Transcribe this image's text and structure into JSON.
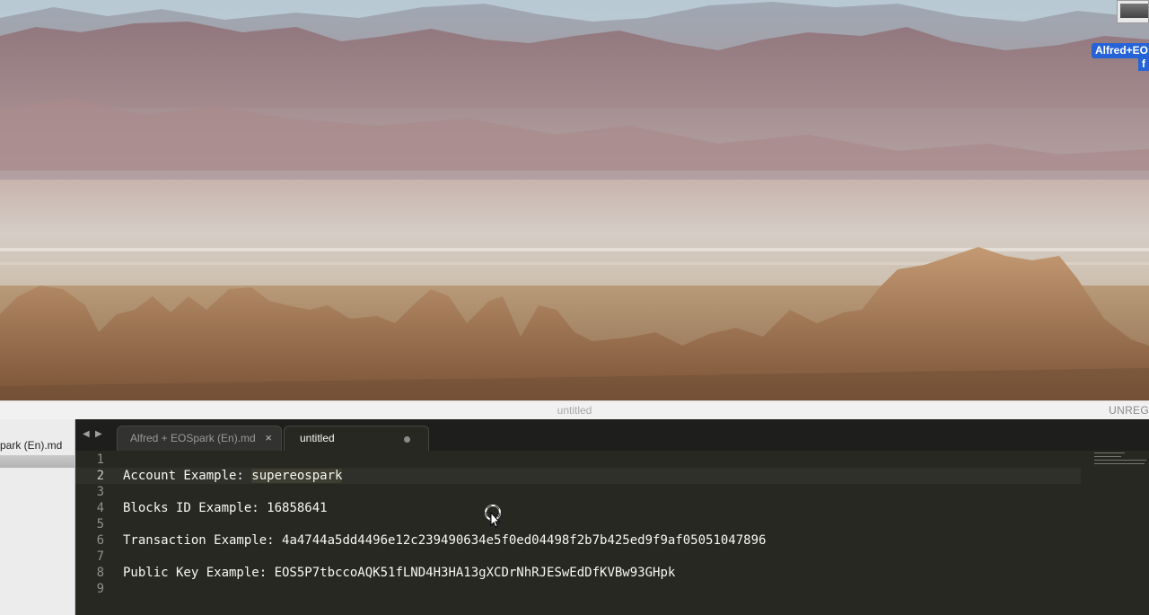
{
  "desktop": {
    "icon_label_line1": "Alfred+EO",
    "icon_label_line2": "f"
  },
  "window": {
    "title": "untitled",
    "unregistered_label": "UNREG"
  },
  "sidebar": {
    "open_file": "park (En).md"
  },
  "tabs": [
    {
      "label": "Alfred + EOSpark (En).md",
      "close_icon": "×"
    },
    {
      "label": "untitled",
      "modified_indicator": "dot"
    }
  ],
  "tab_nav": {
    "back": "◀",
    "forward": "▶"
  },
  "editor": {
    "line_numbers": [
      "1",
      "2",
      "3",
      "4",
      "5",
      "6",
      "7",
      "8",
      "9"
    ],
    "current_line": 2,
    "lines": [
      {
        "label": "",
        "value": ""
      },
      {
        "label": "Account Example: ",
        "value": "supereospark"
      },
      {
        "label": "",
        "value": ""
      },
      {
        "label": "Blocks ID Example: ",
        "value": "16858641"
      },
      {
        "label": "",
        "value": ""
      },
      {
        "label": "Transaction Example: ",
        "value": "4a4744a5dd4496e12c239490634e5f0ed04498f2b7b425ed9f9af05051047896"
      },
      {
        "label": "",
        "value": ""
      },
      {
        "label": "Public Key Example: ",
        "value": "EOS5P7tbccoAQK51fLND4H3HA13gXCDrNhRJESwEdDfKVBw93GHpk"
      },
      {
        "label": "",
        "value": ""
      }
    ]
  },
  "colors": {
    "editor_bg": "#272822",
    "editor_text": "#f8f8f2",
    "gutter_text": "#8f908a",
    "tabbar_bg": "#1e1f1c",
    "desktop_label_bg": "#2563d6"
  }
}
